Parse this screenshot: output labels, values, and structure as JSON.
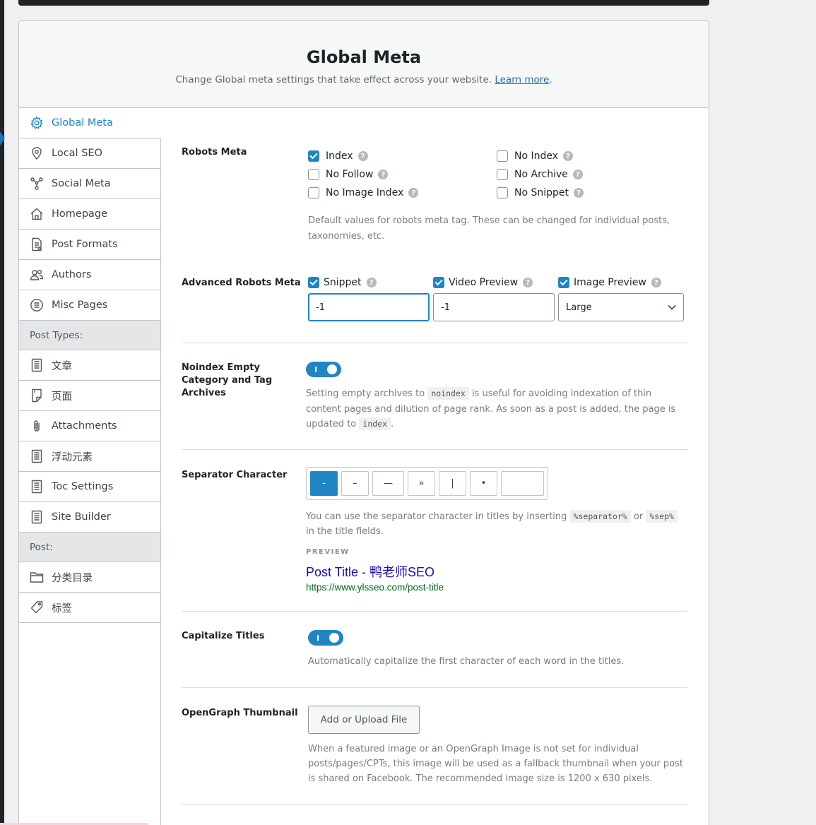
{
  "header": {
    "title": "Global Meta",
    "subtitle": "Change Global meta settings that take effect across your website.",
    "learn_more": "Learn more",
    "period": "."
  },
  "sidebar": {
    "items": [
      {
        "label": "Global Meta",
        "icon": "gear-icon"
      },
      {
        "label": "Local SEO",
        "icon": "location-pin-icon"
      },
      {
        "label": "Social Meta",
        "icon": "social-network-icon"
      },
      {
        "label": "Homepage",
        "icon": "home-icon"
      },
      {
        "label": "Post Formats",
        "icon": "document-icon"
      },
      {
        "label": "Authors",
        "icon": "users-icon"
      },
      {
        "label": "Misc Pages",
        "icon": "list-circle-icon"
      }
    ],
    "post_types_heading": "Post Types:",
    "post_types": [
      {
        "label": "文章",
        "icon": "post-icon"
      },
      {
        "label": "页面",
        "icon": "page-icon"
      },
      {
        "label": "Attachments",
        "icon": "paperclip-icon"
      },
      {
        "label": "浮动元素",
        "icon": "post-icon"
      },
      {
        "label": "Toc Settings",
        "icon": "post-icon"
      },
      {
        "label": "Site Builder",
        "icon": "post-icon"
      }
    ],
    "post_heading": "Post:",
    "post_taxonomies": [
      {
        "label": "分类目录",
        "icon": "folder-icon"
      },
      {
        "label": "标签",
        "icon": "tag-icon"
      }
    ]
  },
  "robots_meta": {
    "label": "Robots Meta",
    "options": [
      {
        "label": "Index",
        "checked": true
      },
      {
        "label": "No Index",
        "checked": false
      },
      {
        "label": "No Follow",
        "checked": false
      },
      {
        "label": "No Archive",
        "checked": false
      },
      {
        "label": "No Image Index",
        "checked": false
      },
      {
        "label": "No Snippet",
        "checked": false
      }
    ],
    "description": "Default values for robots meta tag. These can be changed for individual posts, taxonomies, etc."
  },
  "advanced_robots": {
    "label": "Advanced Robots Meta",
    "snippet_label": "Snippet",
    "snippet_value": "-1",
    "video_label": "Video Preview",
    "video_value": "-1",
    "image_label": "Image Preview",
    "image_value": "Large"
  },
  "noindex_empty": {
    "label": "Noindex Empty Category and Tag Archives",
    "enabled": true,
    "desc_1": "Setting empty archives to",
    "code_1": "noindex",
    "desc_2": "is useful for avoiding indexation of thin content pages and dilution of page rank. As soon as a post is added, the page is updated to",
    "code_2": "index",
    "desc_3": "."
  },
  "separator": {
    "label": "Separator Character",
    "options": [
      "-",
      "–",
      "—",
      "»",
      "|",
      "•"
    ],
    "selected": "-",
    "desc_1": "You can use the separator character in titles by inserting",
    "code_1": "%separator%",
    "desc_or": "or",
    "code_2": "%sep%",
    "desc_2": "in the title fields.",
    "preview_label": "PREVIEW",
    "preview_title": "Post Title - 鸭老师SEO",
    "preview_url": "https://www.ylsseo.com/post-title"
  },
  "capitalize": {
    "label": "Capitalize Titles",
    "enabled": true,
    "description": "Automatically capitalize the first character of each word in the titles."
  },
  "opengraph": {
    "label": "OpenGraph Thumbnail",
    "button": "Add or Upload File",
    "description": "When a featured image or an OpenGraph Image is not set for individual posts/pages/CPTs, this image will be used as a fallback thumbnail when your post is shared on Facebook. The recommended image size is 1200 x 630 pixels."
  },
  "colors": {
    "accent": "#2085c3",
    "link": "#2271b1",
    "preview_title": "#1a0dab",
    "preview_url": "#006621"
  }
}
